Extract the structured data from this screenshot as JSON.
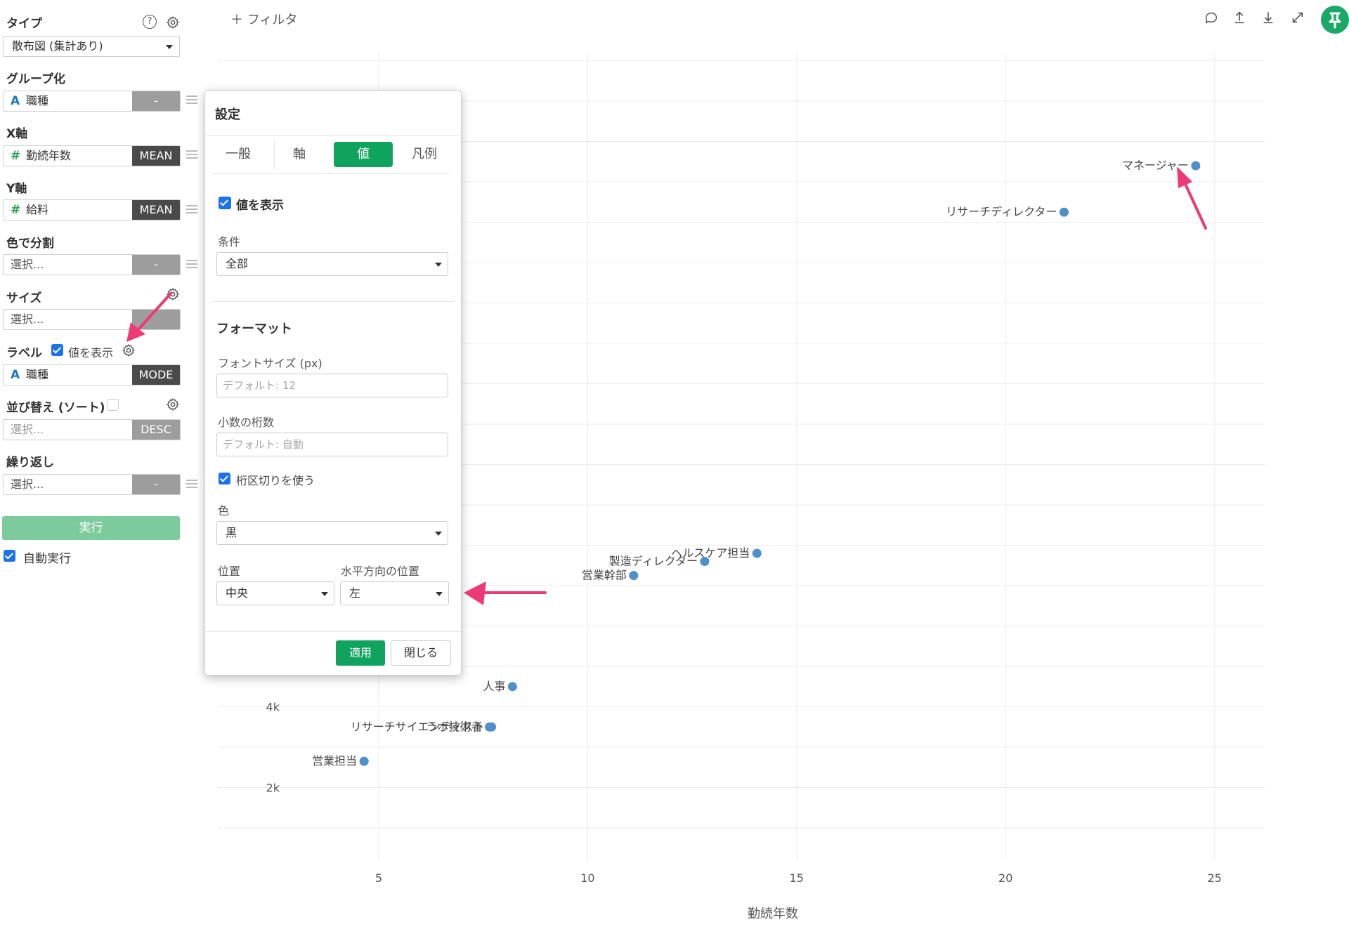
{
  "sidebar": {
    "type": {
      "label": "タイプ",
      "value": "散布図 (集計あり)"
    },
    "group": {
      "label": "グループ化",
      "field": "職種",
      "agg": "-"
    },
    "x_axis": {
      "label": "X軸",
      "field": "勤続年数",
      "agg": "MEAN"
    },
    "y_axis": {
      "label": "Y軸",
      "field": "給料",
      "agg": "MEAN"
    },
    "color_split": {
      "label": "色で分割",
      "placeholder": "選択...",
      "agg": "-"
    },
    "size": {
      "label": "サイズ",
      "placeholder": "選択..."
    },
    "label_sec": {
      "label": "ラベル",
      "show_values_label": "値を表示",
      "show_values_checked": true,
      "field": "職種",
      "agg": "MODE"
    },
    "sort": {
      "label": "並び替え (ソート)",
      "checked": false,
      "placeholder": "選択...",
      "agg": "DESC"
    },
    "repeat": {
      "label": "繰り返し",
      "placeholder": "選択...",
      "agg": "-"
    },
    "run_button": "実行",
    "auto_run": {
      "label": "自動実行",
      "checked": true
    }
  },
  "toolbar": {
    "filter": "フィルタ"
  },
  "dialog": {
    "title": "設定",
    "tabs": [
      "一般",
      "軸",
      "値",
      "凡例"
    ],
    "active_tab": "値",
    "show_values": "値を表示",
    "condition_label": "条件",
    "condition_value": "全部",
    "format_heading": "フォーマット",
    "font_size_label": "フォントサイズ (px)",
    "font_size_placeholder": "デフォルト: 12",
    "decimals_label": "小数の桁数",
    "decimals_placeholder": "デフォルト: 自動",
    "thousands_sep": "桁区切りを使う",
    "color_label": "色",
    "color_value": "黒",
    "position_label": "位置",
    "position_value": "中央",
    "hpos_label": "水平方向の位置",
    "hpos_value": "左",
    "apply": "適用",
    "close": "閉じる"
  },
  "colors": {
    "accent": "#10a35e",
    "point": "#4f8fca",
    "annotation": "#ee3a74"
  },
  "chart_data": {
    "type": "scatter",
    "xlabel": "勤続年数",
    "ylabel": "",
    "x_ticks": [
      "5",
      "10",
      "15",
      "20",
      "25"
    ],
    "y_ticks": [
      "2k",
      "4k"
    ],
    "xlim": [
      1.15,
      26.2
    ],
    "ylim": [
      0.2,
      20.2
    ],
    "points": [
      {
        "label": "マネージャー",
        "x": 24.55,
        "y": 17.4
      },
      {
        "label": "リサーチディレクター",
        "x": 21.4,
        "y": 16.25
      },
      {
        "label": "ヘルスケア担当",
        "x": 14.05,
        "y": 7.8
      },
      {
        "label": "製造ディレクター",
        "x": 12.8,
        "y": 7.6
      },
      {
        "label": "営業幹部",
        "x": 11.1,
        "y": 7.25
      },
      {
        "label": "人事",
        "x": 8.2,
        "y": 4.5
      },
      {
        "label": "リサーチサイエンティスト",
        "x": 7.7,
        "y": 3.5
      },
      {
        "label": "ラボ技術者",
        "x": 7.65,
        "y": 3.5
      },
      {
        "label": "営業担当",
        "x": 4.65,
        "y": 2.65
      }
    ]
  }
}
